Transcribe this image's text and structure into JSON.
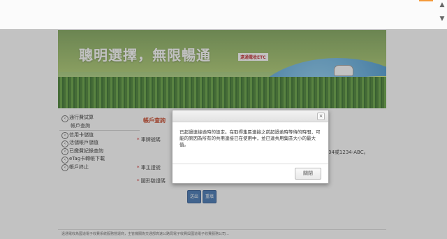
{
  "banner": {
    "title": "聰明選擇，無限暢通",
    "logo_text": "遠通電收ETC"
  },
  "nav": {
    "items": [
      {
        "label": "通行費試算",
        "chevron": true
      },
      {
        "label": "帳戶查詢",
        "chevron": false
      },
      {
        "label": "信用卡儲值",
        "chevron": true
      },
      {
        "label": "活儲帳戶儲值",
        "chevron": true
      },
      {
        "label": "已繳費紀錄查詢",
        "chevron": true
      },
      {
        "label": "eTag卡轉帳下載",
        "chevron": true
      },
      {
        "label": "帳戶終止",
        "chevron": true
      }
    ]
  },
  "main": {
    "title": "帳戶查詢",
    "field_plate": "車牌號碼",
    "field_owner": "車主證號",
    "field_captcha": "圖形驗證碼",
    "hint": "34或1234-ABC。",
    "btn_exit": "送出",
    "btn_clear": "重填"
  },
  "footer": "遠通電收為國道電子收費系統服務營運商，主管機關為交通部高速公路局電子收費與國道電子收費服務公司…",
  "modal": {
    "close_glyph": "×",
    "message": "已超過連接逾時的設定。在取得集區連接之前超過逾時等待的時間，可能的原因為所有的共用連接已在使用中，並已達共用集區大小的最大值。",
    "close_button": "關閉"
  },
  "browser": {
    "scroll_up": "▲",
    "scroll_down": "▼"
  },
  "colors": {
    "accent": "#c53a1a",
    "button_blue": "#3a6fb0"
  }
}
